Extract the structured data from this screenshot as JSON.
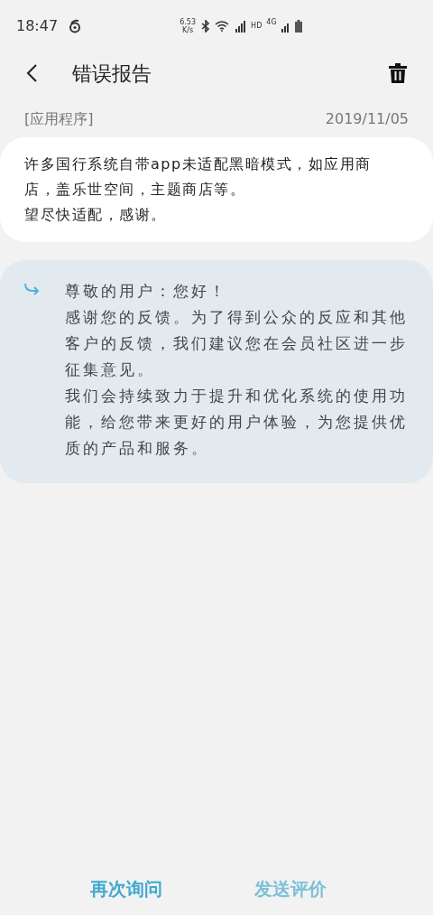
{
  "status_bar": {
    "time": "18:47",
    "net_speed": "6.53 K/s",
    "hd": "HD",
    "network": "4G"
  },
  "header": {
    "title": "错误报告"
  },
  "report": {
    "category": "[应用程序]",
    "date": "2019/11/05",
    "paragraphs": [
      "许多国行系统自带app未适配黑暗模式，如应用商店，盖乐世空间，主题商店等。",
      "望尽快适配，感谢。"
    ]
  },
  "reply": {
    "paragraphs": [
      "尊敬的用户：您好！",
      "感谢您的反馈。为了得到公众的反应和其他客户的反馈，我们建议您在会员社区进一步征集意见。",
      "我们会持续致力于提升和优化系统的使用功能，给您带来更好的用户体验，为您提供优质的产品和服务。"
    ]
  },
  "buttons": [
    {
      "label": "再次询问",
      "disabled": false
    },
    {
      "label": "发送评价",
      "disabled": true
    }
  ]
}
